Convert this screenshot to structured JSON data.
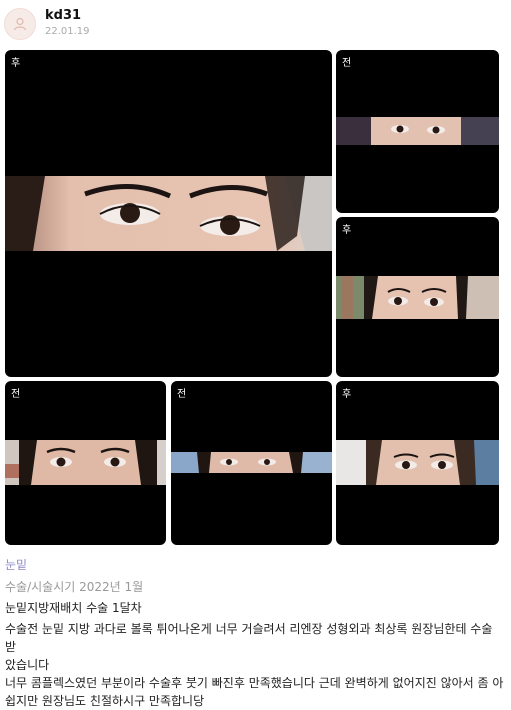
{
  "post": {
    "username": "kd31",
    "date": "22.01.19",
    "avatar_icon": "user-avatar-icon"
  },
  "gallery": {
    "tiles": [
      {
        "tag": "후"
      },
      {
        "tag": "전"
      },
      {
        "tag": "후"
      },
      {
        "tag": "전"
      },
      {
        "tag": "전"
      },
      {
        "tag": "후"
      }
    ]
  },
  "review": {
    "category": "눈밑",
    "meta": "수술/시술시기 2022년 1월",
    "title": "눈밑지방재배치 수술 1달차",
    "body_lines": [
      "수술전 눈밑 지방 과다로 볼록 튀어나온게 너무 거슬려서 리엔장 성형외과 최상록 원장님한테 수술 받",
      "았습니다",
      "너무 콤플렉스였던 부분이라 수술후 붓기 빠진후 만족했습니다 근데 완벽하게 없어지진 않아서 좀 아",
      "쉽지만 원장님도 친절하시구 만족합니당"
    ]
  },
  "colors": {
    "category": "#8c89c8",
    "meta": "#999999",
    "tile_bg": "#000000"
  }
}
